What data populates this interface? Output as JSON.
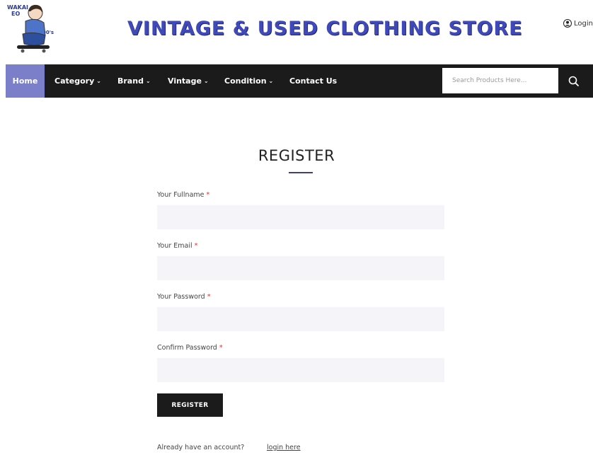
{
  "header": {
    "store_title": "VINTAGE & USED CLOTHING STORE",
    "logo_text_line1": "WAKAI",
    "logo_text_line2": "EO",
    "logo_text_line3": "90's",
    "login_label": "Login"
  },
  "nav": {
    "items": [
      {
        "label": "Home"
      },
      {
        "label": "Category"
      },
      {
        "label": "Brand"
      },
      {
        "label": "Vintage"
      },
      {
        "label": "Condition"
      },
      {
        "label": "Contact Us"
      }
    ],
    "search_placeholder": "Search Products Here..."
  },
  "form": {
    "title": "REGISTER",
    "fields": [
      {
        "label": "Your Fullname",
        "value": ""
      },
      {
        "label": "Your Email",
        "value": ""
      },
      {
        "label": "Your Password",
        "value": ""
      },
      {
        "label": "Confirm Password",
        "value": ""
      }
    ],
    "required_mark": "*",
    "submit_label": "REGISTER",
    "already_text": "Already have an account?",
    "login_link": "login here"
  },
  "colors": {
    "nav_bg": "#1b1b1b",
    "nav_active": "#7b7ec9",
    "title_blue": "#3f4ab8",
    "input_bg": "#f4f4f9",
    "required": "#e03030"
  }
}
